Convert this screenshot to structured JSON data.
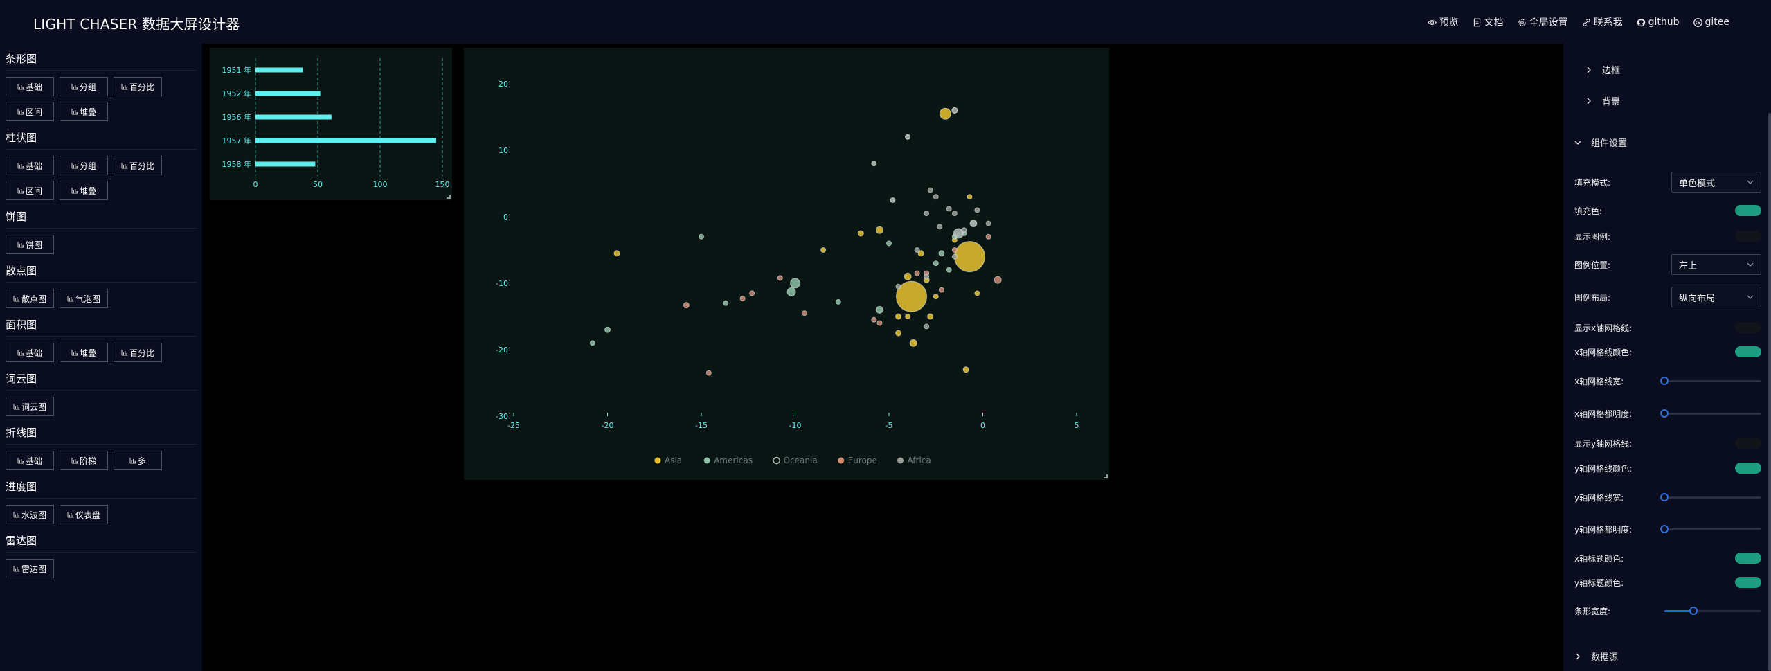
{
  "header": {
    "title": "LIGHT CHASER 数据大屏设计器",
    "nav": [
      {
        "label": "预览",
        "icon": "eye-icon"
      },
      {
        "label": "文档",
        "icon": "document-icon"
      },
      {
        "label": "全局设置",
        "icon": "gear-icon"
      },
      {
        "label": "联系我",
        "icon": "link-icon"
      },
      {
        "label": "github",
        "icon": "github-icon"
      },
      {
        "label": "gitee",
        "icon": "gitee-icon"
      }
    ]
  },
  "left_panel": {
    "icon": "bar-chart-icon",
    "categories": [
      {
        "title": "条形图",
        "items": [
          "基础",
          "分组",
          "百分比",
          "区间",
          "堆叠"
        ]
      },
      {
        "title": "柱状图",
        "items": [
          "基础",
          "分组",
          "百分比",
          "区间",
          "堆叠"
        ]
      },
      {
        "title": "饼图",
        "items": [
          "饼图"
        ]
      },
      {
        "title": "散点图",
        "items": [
          "散点图",
          "气泡图"
        ]
      },
      {
        "title": "面积图",
        "items": [
          "基础",
          "堆叠",
          "百分比"
        ]
      },
      {
        "title": "词云图",
        "items": [
          "词云图"
        ]
      },
      {
        "title": "折线图",
        "items": [
          "基础",
          "阶梯",
          "多"
        ]
      },
      {
        "title": "进度图",
        "items": [
          "水波图",
          "仪表盘"
        ]
      },
      {
        "title": "雷达图",
        "items": [
          "雷达图"
        ]
      }
    ]
  },
  "chart_data": [
    {
      "type": "bar",
      "orientation": "horizontal",
      "categories": [
        "1951 年",
        "1952 年",
        "1956 年",
        "1957 年",
        "1958 年"
      ],
      "values": [
        38,
        52,
        61,
        145,
        48
      ],
      "xlim": [
        0,
        150
      ],
      "xticks": [
        "0",
        "50",
        "100",
        "150"
      ],
      "color": "#5ef0f0",
      "grid": "vertical dashed"
    },
    {
      "type": "scatter",
      "variant": "bubble",
      "xlim": [
        -25,
        5
      ],
      "ylim": [
        -30,
        20
      ],
      "xticks": [
        "-25",
        "-20",
        "-15",
        "-10",
        "-5",
        "0",
        "5"
      ],
      "yticks": [
        "20",
        "10",
        "0",
        "-10",
        "-20",
        "-30"
      ],
      "legend_position": "bottom",
      "series": [
        {
          "name": "Asia",
          "color": "#e8c22e",
          "points": [
            [
              -2,
              15.5,
              8
            ],
            [
              -19.5,
              -5.5,
              4
            ],
            [
              -8.5,
              -5,
              3.5
            ],
            [
              -6.5,
              -2.5,
              4
            ],
            [
              -5.5,
              -2,
              5
            ],
            [
              -3.3,
              -5.5,
              4
            ],
            [
              -4,
              -9,
              5
            ],
            [
              -0.7,
              -6,
              22
            ],
            [
              -3.8,
              -12,
              22
            ],
            [
              -3,
              -9.5,
              4
            ],
            [
              -2.5,
              -12,
              3.5
            ],
            [
              -4.5,
              -15,
              4
            ],
            [
              -2.8,
              -15,
              4
            ],
            [
              -4,
              -15,
              3.5
            ],
            [
              -3.7,
              -19,
              5
            ],
            [
              -0.9,
              -23,
              4
            ],
            [
              -0.7,
              3,
              3.5
            ],
            [
              -0.3,
              -11.5,
              3.5
            ],
            [
              -1.5,
              -3.5,
              3.5
            ],
            [
              -4.5,
              -17.5,
              4
            ]
          ]
        },
        {
          "name": "Americas",
          "color": "#8ec3a7",
          "points": [
            [
              -15,
              -3,
              3.5
            ],
            [
              -20,
              -17,
              4
            ],
            [
              -20.8,
              -19,
              3.5
            ],
            [
              -13.7,
              -13,
              3.5
            ],
            [
              -10,
              -10,
              7
            ],
            [
              -10.2,
              -11.3,
              6
            ],
            [
              -7.7,
              -12.8,
              3.5
            ],
            [
              -5.5,
              -14,
              5
            ],
            [
              -2.2,
              -5.5,
              4
            ],
            [
              -1.5,
              -3,
              3.5
            ],
            [
              -1,
              -2.5,
              3.5
            ],
            [
              -2.5,
              -7,
              3.5
            ],
            [
              -1.8,
              -8,
              3.5
            ],
            [
              -5,
              -4,
              3.5
            ]
          ]
        },
        {
          "name": "Oceania",
          "color": "#b8c4be",
          "points": [
            [
              -1.5,
              16,
              4
            ],
            [
              -4,
              12,
              3.5
            ],
            [
              -5.8,
              8,
              3.5
            ],
            [
              -1.3,
              -2.5,
              7
            ],
            [
              -0.5,
              -1,
              5
            ],
            [
              -4.8,
              2.5,
              3.5
            ]
          ]
        },
        {
          "name": "Europe",
          "color": "#d08a72",
          "points": [
            [
              -15.8,
              -13.3,
              4
            ],
            [
              -14.6,
              -23.5,
              3.5
            ],
            [
              -12.8,
              -12.3,
              3.5
            ],
            [
              -12.3,
              -11.5,
              3.5
            ],
            [
              -10.8,
              -9.2,
              3.5
            ],
            [
              -9.5,
              -14.5,
              3.5
            ],
            [
              -5.5,
              -16,
              3.5
            ],
            [
              -5.8,
              -15.5,
              3.5
            ],
            [
              -3.5,
              -8.5,
              3.5
            ],
            [
              -3,
              -8.5,
              3.5
            ],
            [
              0.8,
              -9.5,
              5
            ],
            [
              -2.2,
              -11,
              3.5
            ],
            [
              0.3,
              -3,
              3.5
            ],
            [
              -1.5,
              -5,
              3.5
            ]
          ]
        },
        {
          "name": "Africa",
          "color": "#9aa09a",
          "points": [
            [
              -1.5,
              16,
              4
            ],
            [
              -4,
              12,
              3.5
            ],
            [
              -3,
              0.5,
              3.5
            ],
            [
              -2.3,
              -1.5,
              3.5
            ],
            [
              -0.3,
              1,
              3.5
            ],
            [
              0.3,
              -1,
              3.5
            ],
            [
              -3.5,
              -5,
              3.5
            ],
            [
              -1.8,
              1.2,
              3.5
            ],
            [
              -2.5,
              3,
              3.5
            ],
            [
              -3,
              -9,
              3.5
            ],
            [
              -4.5,
              -10.5,
              3.5
            ],
            [
              -3,
              -16.5,
              3.5
            ],
            [
              -2.8,
              4,
              3.5
            ],
            [
              -1,
              -2,
              3.5
            ],
            [
              -1.5,
              -6,
              3.5
            ],
            [
              -1.5,
              0.5,
              3.5
            ]
          ]
        }
      ]
    }
  ],
  "right_panel": {
    "sections": [
      "边框",
      "背景",
      "组件设置",
      "数据源"
    ],
    "fill_mode_label": "填充模式:",
    "fill_mode_value": "单色模式",
    "fill_color_label": "填充色:",
    "fill_color": "#1e9c80",
    "show_legend_label": "显示图例:",
    "legend_position_label": "图例位置:",
    "legend_position_value": "左上",
    "legend_layout_label": "图例布局:",
    "legend_layout_value": "纵向布局",
    "show_x_grid_label": "显示x轴网格线:",
    "x_grid_color_label": "x轴网格线颜色:",
    "x_grid_width_label": "x轴网格线宽:",
    "x_grid_opacity_label": "x轴网格都明度:",
    "show_y_grid_label": "显示y轴网格线:",
    "y_grid_color_label": "y轴网格线颜色:",
    "y_grid_width_label": "y轴网格线宽:",
    "y_grid_opacity_label": "y轴网格都明度:",
    "x_title_color_label": "x轴标题颜色:",
    "y_title_color_label": "y轴标题颜色:",
    "bar_width_label": "条形宽度:",
    "x_grid_width_value": 0,
    "x_grid_opacity_value": 0,
    "y_grid_width_value": 0,
    "y_grid_opacity_value": 0,
    "bar_width_value": 0.3
  }
}
